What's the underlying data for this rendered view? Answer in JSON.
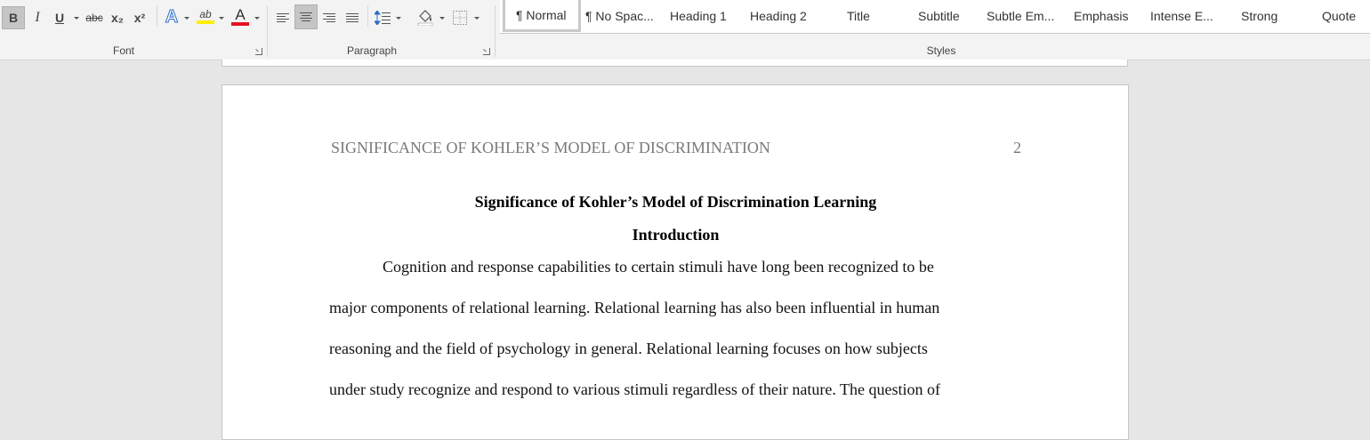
{
  "ribbon": {
    "font_group": {
      "label": "Font",
      "buttons": {
        "bold": "B",
        "italic": "I",
        "underline": "U",
        "strikethrough": "abc",
        "subscript": "x₂",
        "superscript": "x²",
        "text_effects": "A",
        "highlight": "ab",
        "font_color": "A"
      },
      "highlight_color": "#ffee00",
      "font_color_bar": "#e81123"
    },
    "paragraph_group": {
      "label": "Paragraph"
    },
    "styles_group": {
      "label": "Styles",
      "items": [
        "¶ Normal",
        "¶ No Spac...",
        "Heading 1",
        "Heading 2",
        "Title",
        "Subtitle",
        "Subtle Em...",
        "Emphasis",
        "Intense E...",
        "Strong",
        "Quote"
      ],
      "selected": "¶ Normal"
    }
  },
  "document": {
    "running_head": "SIGNIFICANCE OF KOHLER’S MODEL OF DISCRIMINATION",
    "page_number": "2",
    "title": "Significance of Kohler’s Model of Discrimination Learning",
    "heading": "Introduction",
    "lines": [
      "Cognition and response capabilities to certain stimuli have long been recognized to be",
      "major components of relational learning. Relational learning has also been influential in human",
      "reasoning and the field of psychology in general. Relational learning focuses on how subjects",
      "under study recognize and respond to various stimuli regardless of their nature. The question of"
    ]
  }
}
